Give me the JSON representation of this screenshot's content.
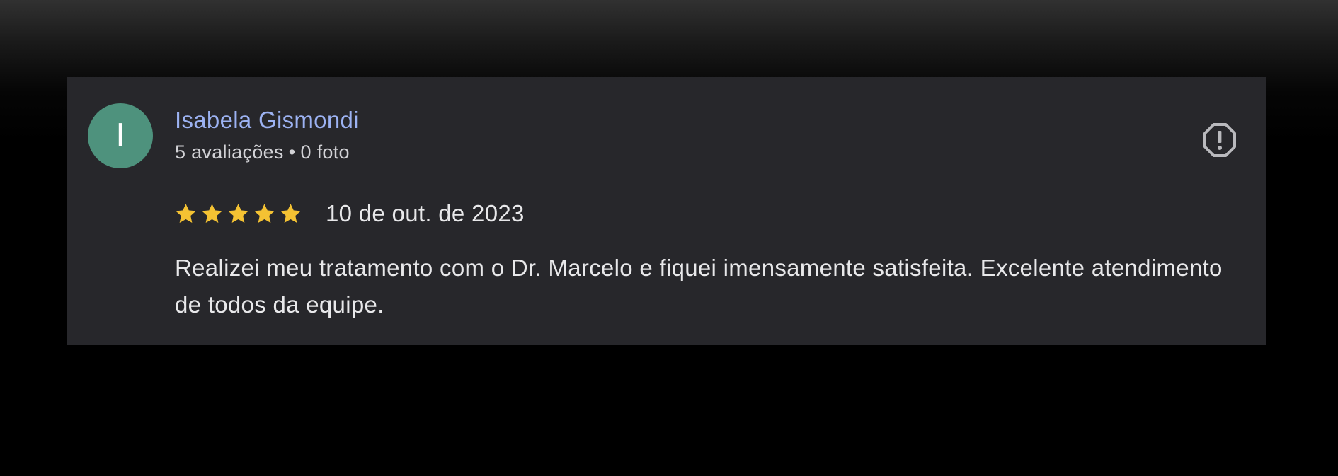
{
  "review": {
    "avatar_initial": "I",
    "avatar_color": "#4e927d",
    "reviewer_name": "Isabela Gismondi",
    "reviews_count": "5 avaliações",
    "separator": "•",
    "photos_count": "0 foto",
    "rating": 5,
    "rating_max": 5,
    "star_color": "#f4c233",
    "date": "10 de out. de 2023",
    "text": "Realizei meu tratamento com o Dr. Marcelo e fiquei imensamente satisfeita. Excelente atendimento de todos da equipe.",
    "report_icon": "report-octagon-icon"
  }
}
